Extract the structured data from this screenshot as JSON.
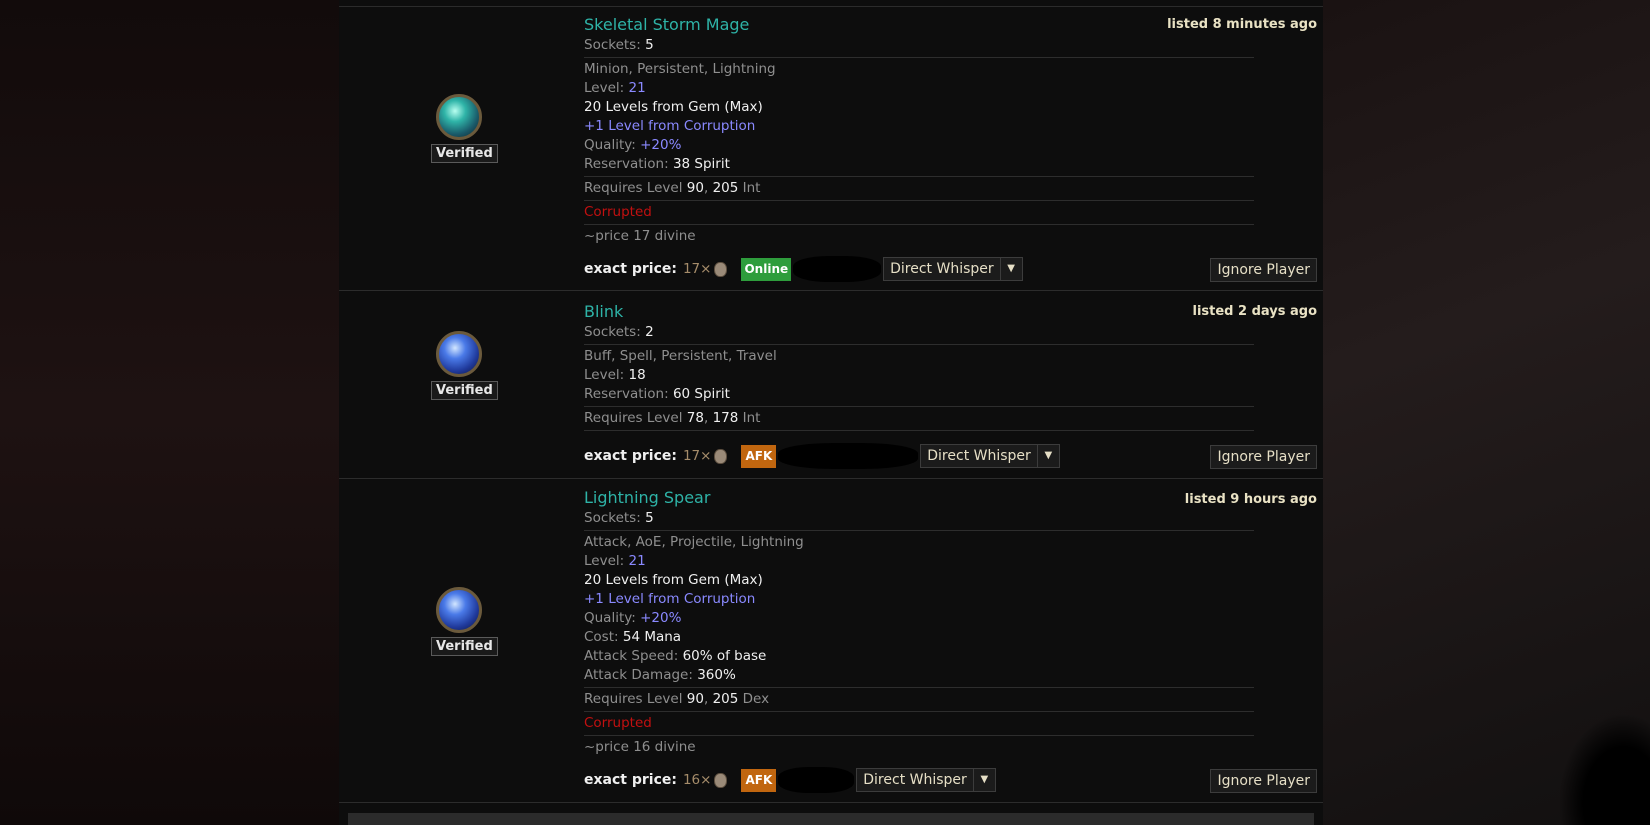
{
  "listings": [
    {
      "name": "Skeletal Storm Mage",
      "listed": "listed 8 minutes ago",
      "gem_color": "green",
      "verified": "Verified",
      "sockets_label": "Sockets:",
      "sockets": "5",
      "tags": "Minion, Persistent, Lightning",
      "level_label": "Level:",
      "level": "21",
      "gem_levels": "20 Levels from Gem (Max)",
      "corruption_levels": "+1 Level from Corruption",
      "quality_label": "Quality:",
      "quality": "+20%",
      "reservation_label": "Reservation:",
      "reservation": "38 Spirit",
      "req_prefix": "Requires Level",
      "req_level": "90",
      "req_stat": "205",
      "req_stat_name": "Int",
      "corrupted": "Corrupted",
      "note": "~price 17 divine",
      "exact_price_label": "exact price:",
      "price_count": "17×",
      "status": "Online",
      "whisper": "Direct Whisper",
      "ignore": "Ignore Player"
    },
    {
      "name": "Blink",
      "listed": "listed 2 days ago",
      "gem_color": "blue",
      "verified": "Verified",
      "sockets_label": "Sockets:",
      "sockets": "2",
      "tags": "Buff, Spell, Persistent, Travel",
      "level_label": "Level:",
      "level": "18",
      "reservation_label": "Reservation:",
      "reservation": "60 Spirit",
      "req_prefix": "Requires Level",
      "req_level": "78",
      "req_stat": "178",
      "req_stat_name": "Int",
      "exact_price_label": "exact price:",
      "price_count": "17×",
      "status": "AFK",
      "whisper": "Direct Whisper",
      "ignore": "Ignore Player"
    },
    {
      "name": "Lightning Spear",
      "listed": "listed 9 hours ago",
      "gem_color": "blue",
      "verified": "Verified",
      "sockets_label": "Sockets:",
      "sockets": "5",
      "tags": "Attack, AoE, Projectile, Lightning",
      "level_label": "Level:",
      "level": "21",
      "gem_levels": "20 Levels from Gem (Max)",
      "corruption_levels": "+1 Level from Corruption",
      "quality_label": "Quality:",
      "quality": "+20%",
      "cost_label": "Cost:",
      "cost": "54 Mana",
      "attack_speed_label": "Attack Speed:",
      "attack_speed": "60% of base",
      "attack_damage_label": "Attack Damage:",
      "attack_damage": "360%",
      "req_prefix": "Requires Level",
      "req_level": "90",
      "req_stat": "205",
      "req_stat_name": "Dex",
      "corrupted": "Corrupted",
      "note": "~price 16 divine",
      "exact_price_label": "exact price:",
      "price_count": "16×",
      "status": "AFK",
      "whisper": "Direct Whisper",
      "ignore": "Ignore Player"
    }
  ],
  "colors": {
    "gem_name": "#2eb3a7",
    "augmented_value": "#8a89ff",
    "corrupted": "#c21010",
    "online": "#2e9d3c",
    "afk": "#c1660f"
  },
  "icons": {
    "currency": "divine-orb-icon",
    "dropdown": "chevron-down-icon"
  }
}
